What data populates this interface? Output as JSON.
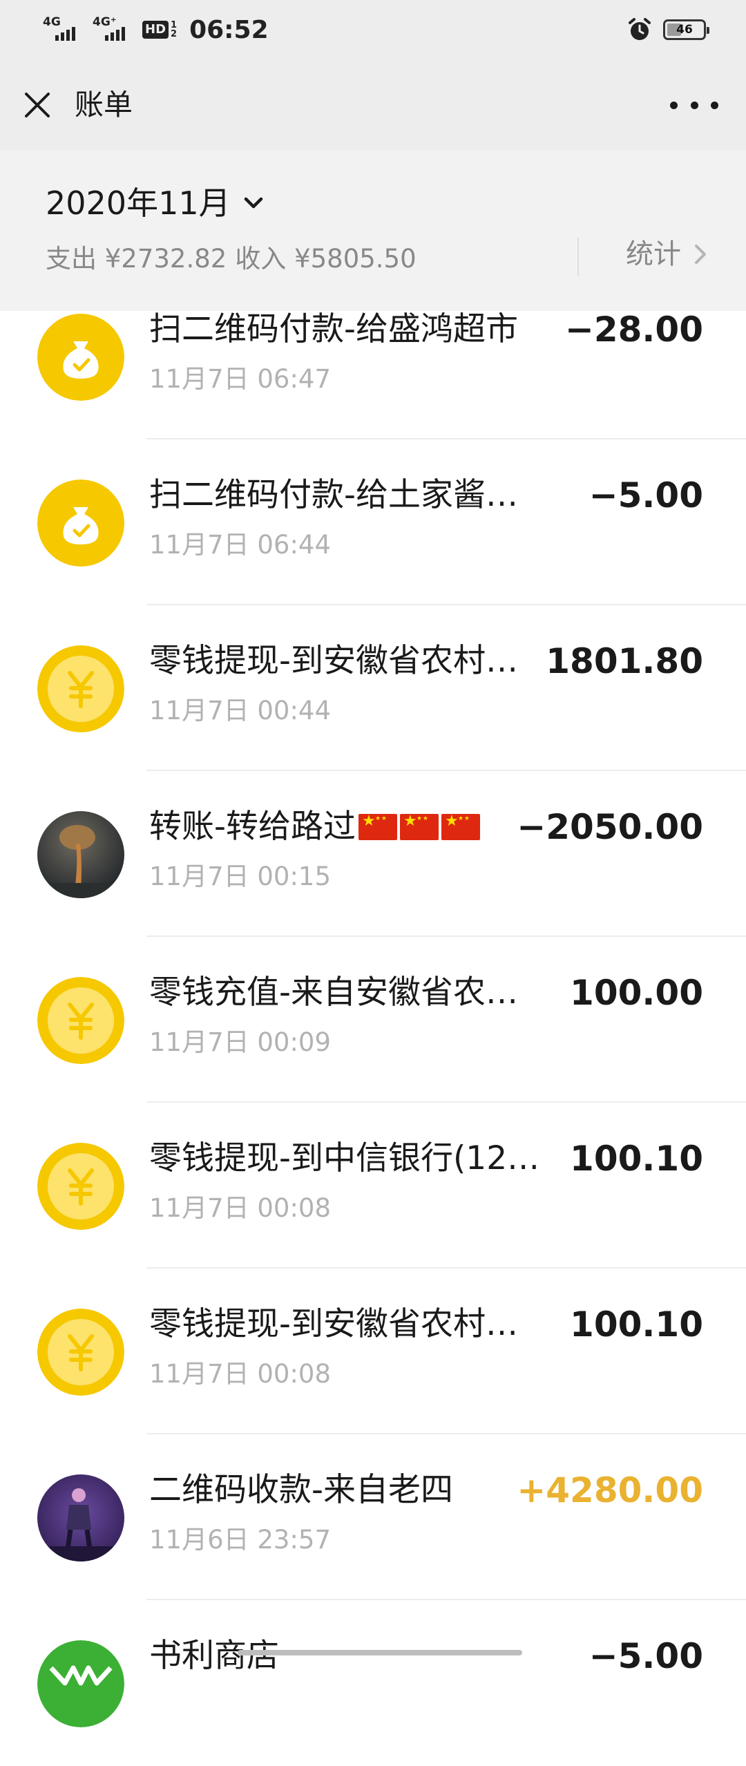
{
  "status_bar": {
    "net1": "4G",
    "net2": "4G⁺",
    "hd": "HD",
    "hd_frac_top": "1",
    "hd_frac_bottom": "2",
    "time": "06:52",
    "battery": "46",
    "battery_level": 0.46
  },
  "nav": {
    "title": "账单"
  },
  "summary": {
    "month": "2020年11月",
    "expense": "支出 ¥2732.82",
    "income": "收入 ¥5805.50",
    "stats_label": "统计"
  },
  "colors": {
    "gold": "#f6c800",
    "gold_light": "#fde26b",
    "income_text": "#eab231",
    "green": "#3cb034"
  },
  "transactions": [
    {
      "title": "扫二维码付款-给盛鸿超市",
      "time": "11月7日 06:47",
      "amount": "−28.00",
      "icon": "money-bag-icon"
    },
    {
      "title": "扫二维码付款-给土家酱…",
      "time": "11月7日 06:44",
      "amount": "−5.00",
      "icon": "money-bag-icon"
    },
    {
      "title": "零钱提现-到安徽省农村…",
      "time": "11月7日 00:44",
      "amount": "1801.80",
      "icon": "yuan-coin-icon"
    },
    {
      "title": "转账-转给路过",
      "time": "11月7日 00:15",
      "amount": "−2050.00",
      "icon": "user-avatar-photo",
      "flag_count": 3
    },
    {
      "title": "零钱充值-来自安徽省农…",
      "time": "11月7日 00:09",
      "amount": "100.00",
      "icon": "yuan-coin-icon"
    },
    {
      "title": "零钱提现-到中信银行(12…",
      "time": "11月7日 00:08",
      "amount": "100.10",
      "icon": "yuan-coin-icon"
    },
    {
      "title": "零钱提现-到安徽省农村…",
      "time": "11月7日 00:08",
      "amount": "100.10",
      "icon": "yuan-coin-icon"
    },
    {
      "title": "二维码收款-来自老四",
      "time": "11月6日 23:57",
      "amount": "+4280.00",
      "icon": "user-avatar-photo",
      "income": true
    },
    {
      "title": "书利商店",
      "time": "",
      "amount": "−5.00",
      "icon": "merchant-green-icon"
    }
  ]
}
